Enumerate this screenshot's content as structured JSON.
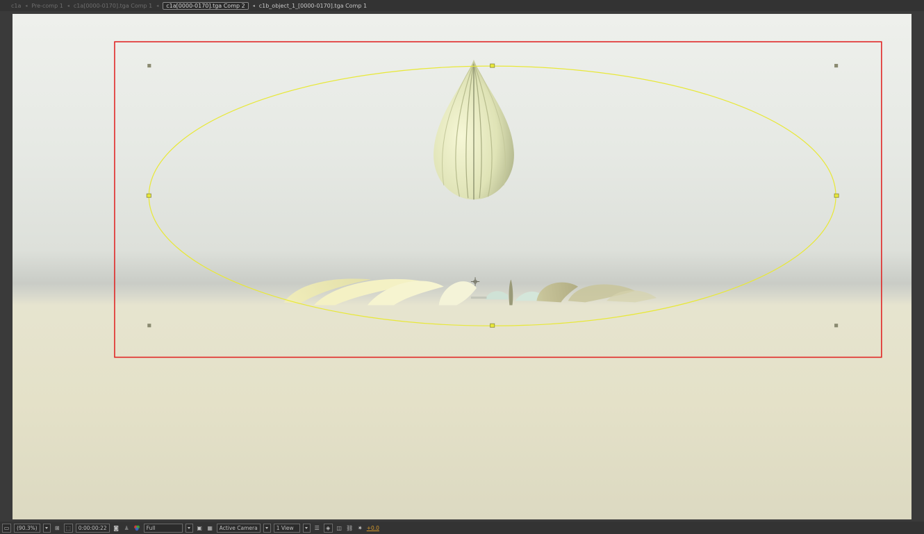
{
  "breadcrumbs": [
    {
      "label": "c1a",
      "state": "inactive"
    },
    {
      "label": "Pre-comp 1",
      "state": "inactive"
    },
    {
      "label": "c1a[0000-0170].tga Comp 1",
      "state": "inactive"
    },
    {
      "label": "c1a[0000-0170].tga Comp 2",
      "state": "active"
    },
    {
      "label": "c1b_object_1_[0000-0170].tga Comp 1",
      "state": "normal"
    }
  ],
  "toolbar": {
    "magnification": "(90.3%)",
    "timecode": "0:00:00:22",
    "resolution": "Full",
    "camera": "Active Camera",
    "view_layout": "1 View",
    "exposure": "+0.0"
  },
  "colors": {
    "selection_box": "#e02020",
    "mask_path": "#e8e838",
    "handle": "#8a8a70",
    "exposure_accent": "#d69a2c"
  },
  "icons": {
    "always_preview": "monitor-icon",
    "grid": "grid-guides-icon",
    "mask_visibility": "mask-toggle-icon",
    "snapshot": "camera-icon",
    "show_snapshot": "person-icon",
    "channel": "rgb-channel-icon",
    "region_of_interest": "roi-icon",
    "transparency_grid": "checkerboard-icon",
    "draft3d": "draft-3d-icon",
    "flowchart": "flowchart-icon",
    "fast_previews": "fast-previews-icon"
  }
}
